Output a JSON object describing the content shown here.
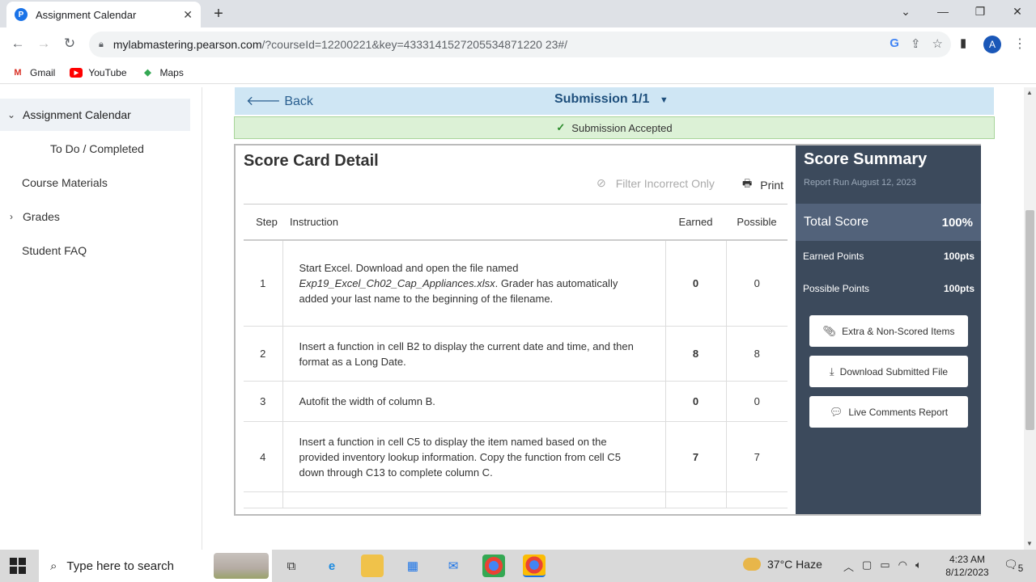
{
  "browser": {
    "tab_title": "Assignment Calendar",
    "favicon_letter": "P",
    "url_host": "mylabmastering.pearson.com",
    "url_rest": "/?courseId=12200221&key=4333141527205534871220 23#/",
    "profile_letter": "A",
    "bookmarks": [
      {
        "label": "Gmail",
        "icon": "gmail-icon",
        "color": "#d93025"
      },
      {
        "label": "YouTube",
        "icon": "youtube-icon",
        "color": "#ff0000"
      },
      {
        "label": "Maps",
        "icon": "maps-icon",
        "color": "#34a853"
      }
    ]
  },
  "sidebar": {
    "items": [
      {
        "label": "Assignment Calendar"
      },
      {
        "label": "To Do / Completed"
      },
      {
        "label": "Course Materials"
      },
      {
        "label": "Grades"
      },
      {
        "label": "Student FAQ"
      }
    ]
  },
  "header": {
    "back_label": "Back",
    "submission_label": "Submission 1/1",
    "accepted_label": "Submission Accepted"
  },
  "scorecard": {
    "title": "Score Card Detail",
    "filter_label": "Filter Incorrect Only",
    "print_label": "Print",
    "columns": {
      "step": "Step",
      "instruction": "Instruction",
      "earned": "Earned",
      "possible": "Possible"
    },
    "rows": [
      {
        "step": "1",
        "earned": "0",
        "possible": "0",
        "instr_a": "Start Excel. Download and open the file named ",
        "instr_file": "Exp19_Excel_Ch02_Cap_Appliances.xlsx",
        "instr_b": ". Grader has automatically added your last name to the beginning of the filename."
      },
      {
        "step": "2",
        "earned": "8",
        "possible": "8",
        "instruction": "Insert a function in cell B2 to display the current date and time, and then format as a Long Date."
      },
      {
        "step": "3",
        "earned": "0",
        "possible": "0",
        "instruction": "Autofit the width of column B."
      },
      {
        "step": "4",
        "earned": "7",
        "possible": "7",
        "instruction": "Insert a function in cell C5 to display the item named based on the provided inventory lookup information. Copy the function from cell C5 down through C13 to complete column C."
      }
    ]
  },
  "summary": {
    "title": "Score Summary",
    "report_run": "Report Run August 12, 2023",
    "total_label": "Total Score",
    "total_value": "100%",
    "earned_label": "Earned Points",
    "earned_value": "100pts",
    "possible_label": "Possible Points",
    "possible_value": "100pts",
    "buttons": {
      "extra": "Extra & Non-Scored Items",
      "download": "Download Submitted File",
      "comments": "Live Comments Report"
    }
  },
  "taskbar": {
    "search_placeholder": "Type here to search",
    "weather": "37°C  Haze",
    "time": "4:23 AM",
    "date": "8/12/2023",
    "notifications": "5"
  }
}
